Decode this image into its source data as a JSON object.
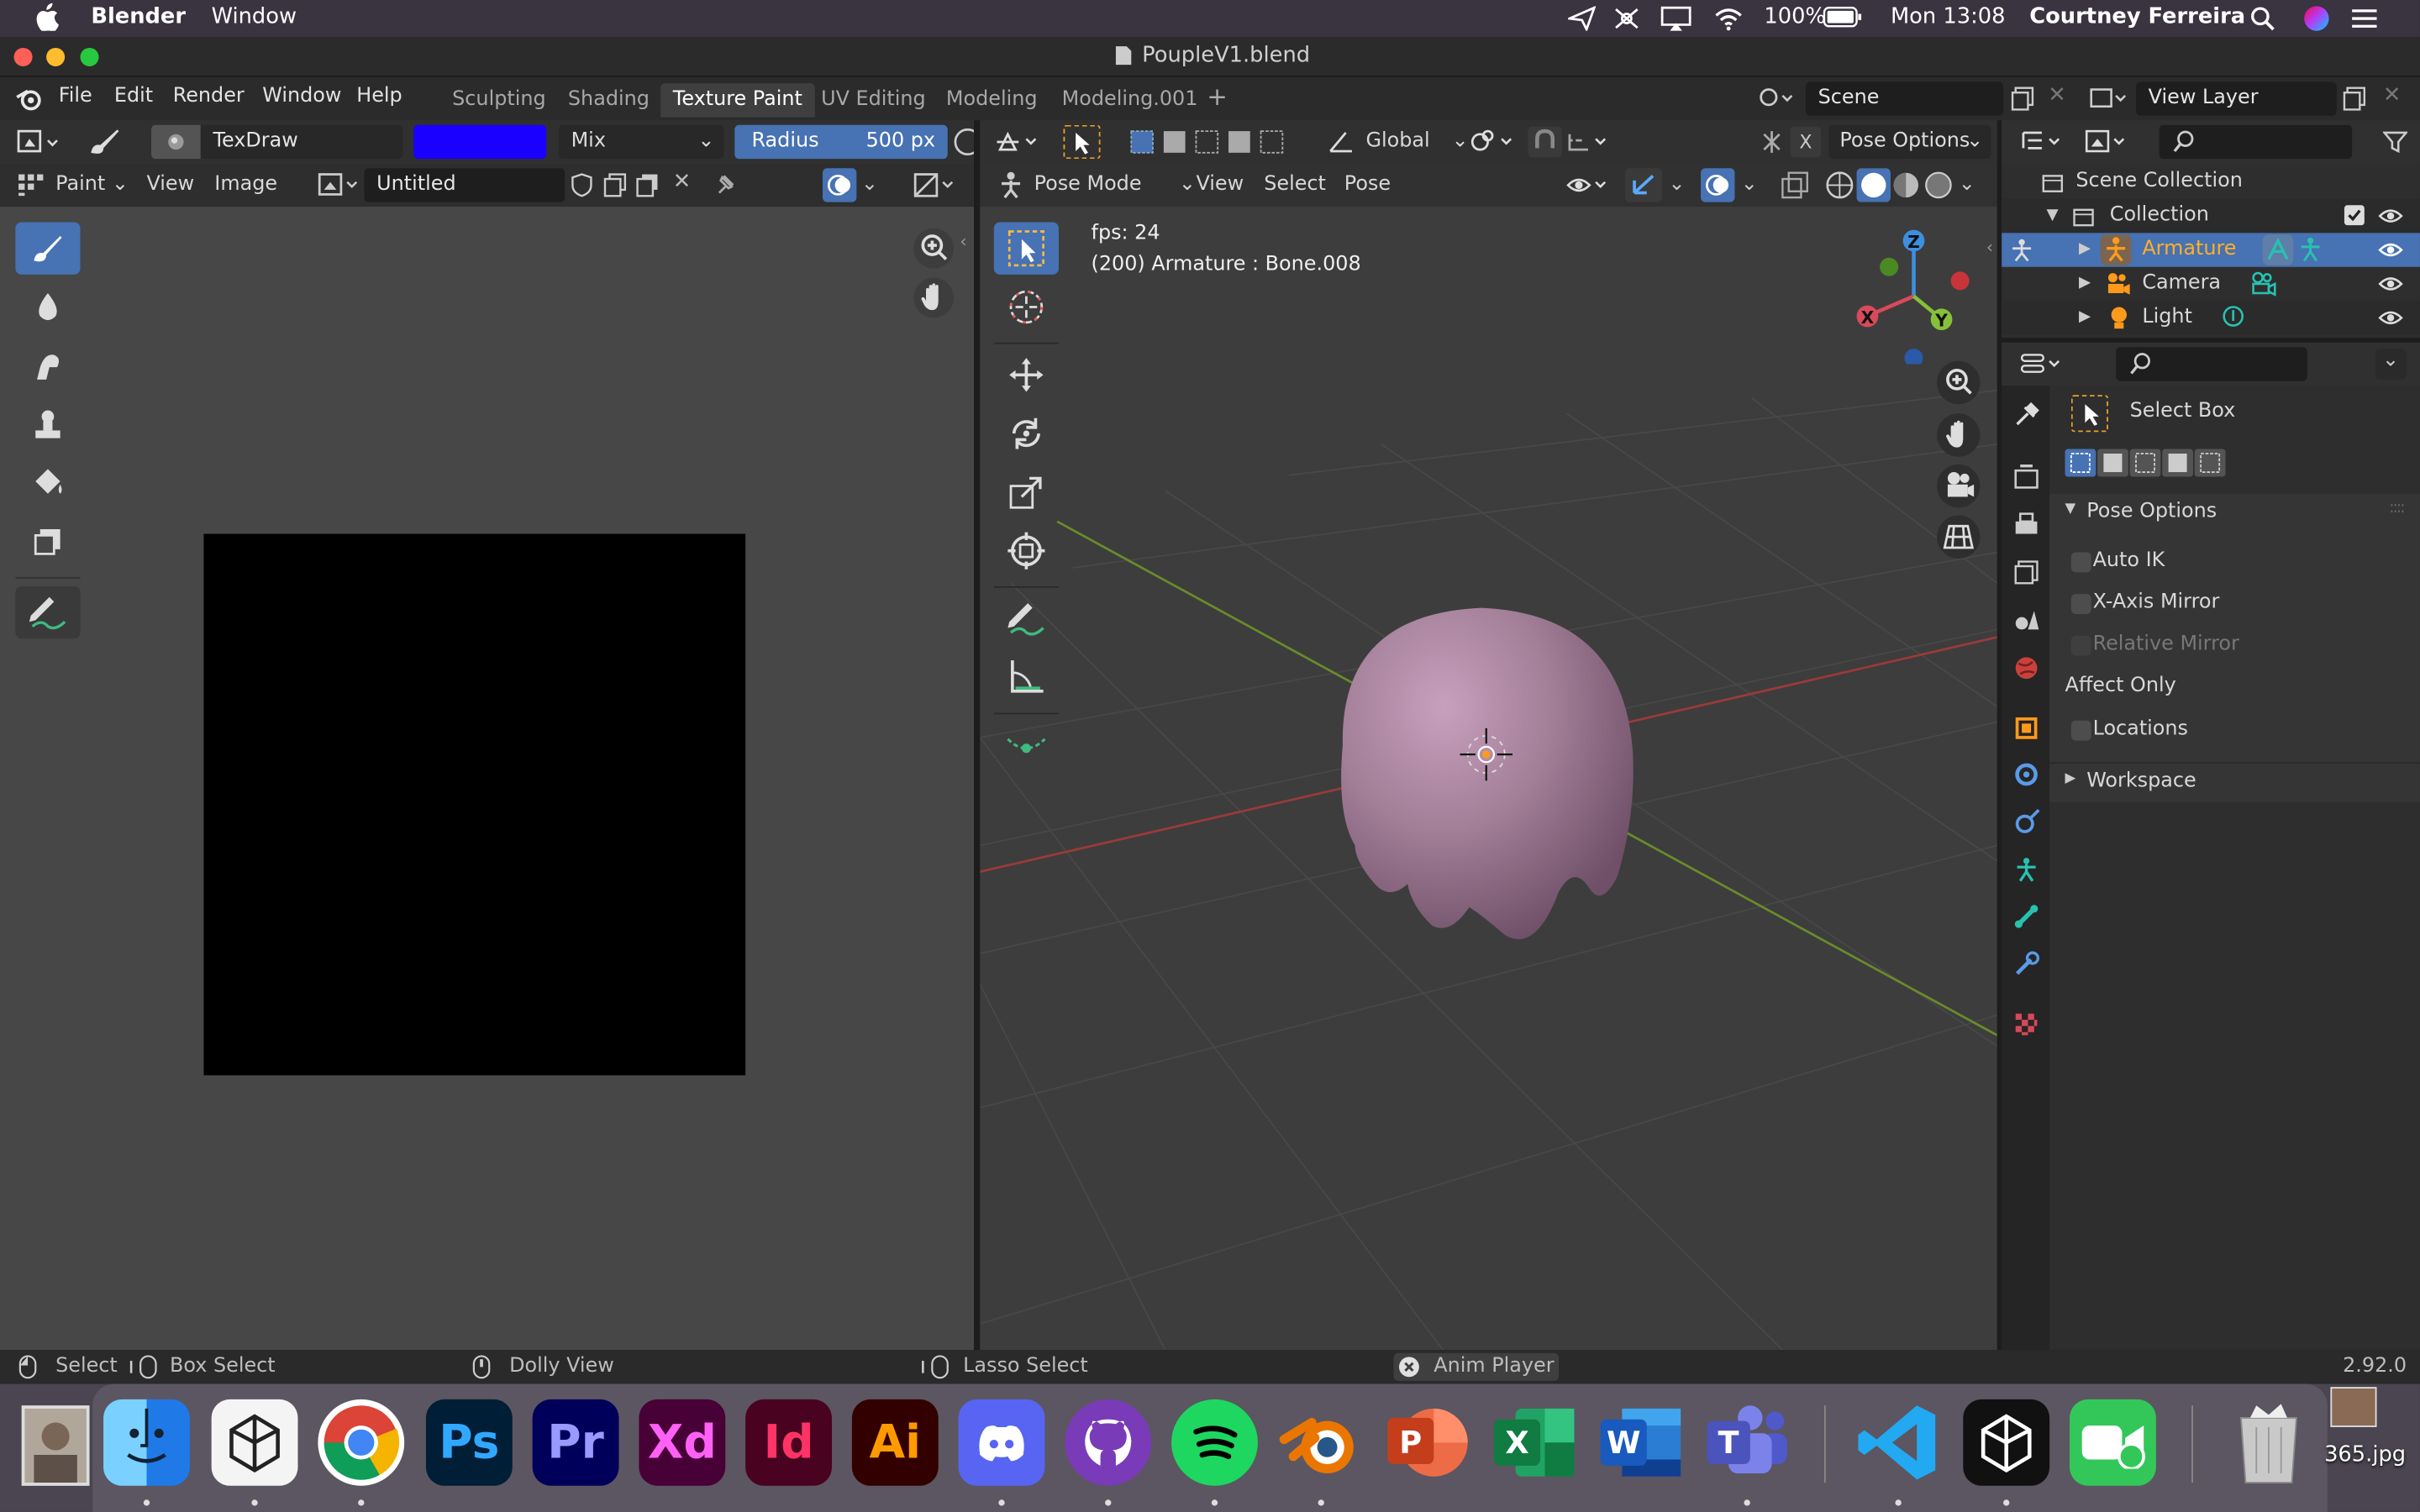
{
  "macos": {
    "app_name": "Blender",
    "menu": [
      "Window"
    ],
    "battery": "100%",
    "clock": "Mon 13:08",
    "user": "Courtney Ferreira"
  },
  "window": {
    "title": "PoupleV1.blend"
  },
  "top_menu": [
    "File",
    "Edit",
    "Render",
    "Window",
    "Help"
  ],
  "workspace_tabs": [
    {
      "label": "Sculpting",
      "active": false
    },
    {
      "label": "Shading",
      "active": false
    },
    {
      "label": "Texture Paint",
      "active": true
    },
    {
      "label": "UV Editing",
      "active": false
    },
    {
      "label": "Modeling",
      "active": false
    },
    {
      "label": "Modeling.001",
      "active": false
    }
  ],
  "scene": {
    "name": "Scene",
    "view_layer": "View Layer"
  },
  "image_editor": {
    "brush_name": "TexDraw",
    "brush_color": "#1a00ff",
    "blend_mode": "Mix",
    "radius_label": "Radius",
    "radius_value": "500 px",
    "mode": "Paint",
    "menus": [
      "View",
      "Image"
    ],
    "image_name": "Untitled"
  },
  "viewport": {
    "orientation": "Global",
    "pose_options": "Pose Options",
    "mode": "Pose Mode",
    "menus": [
      "View",
      "Select",
      "Pose"
    ],
    "fps": "fps: 24",
    "info": "(200) Armature : Bone.008",
    "axes": [
      "Z",
      "X",
      "Y"
    ]
  },
  "outliner": {
    "root": "Scene Collection",
    "collection": "Collection",
    "items": [
      {
        "label": "Armature",
        "selected": true
      },
      {
        "label": "Camera",
        "selected": false
      },
      {
        "label": "Light",
        "selected": false
      }
    ]
  },
  "properties": {
    "tool": "Select Box",
    "section": "Pose Options",
    "options": [
      {
        "label": "Auto IK",
        "checked": false,
        "disabled": false
      },
      {
        "label": "X-Axis Mirror",
        "checked": false,
        "disabled": false
      },
      {
        "label": "Relative Mirror",
        "checked": false,
        "disabled": true
      }
    ],
    "affect_only_label": "Affect Only",
    "locations_label": "Locations",
    "workspace_label": "Workspace"
  },
  "status": {
    "select": "Select",
    "box_select": "Box Select",
    "dolly": "Dolly View",
    "lasso": "Lasso Select",
    "anim_player": "Anim Player",
    "version": "2.92.0"
  },
  "dock": {
    "apps": [
      "Finder",
      "Unity",
      "Chrome",
      "Ps",
      "Pr",
      "Xd",
      "Id",
      "Ai",
      "Discord",
      "GitHub Desktop",
      "Spotify",
      "Blender",
      "PowerPoint",
      "Excel",
      "Word",
      "Teams",
      "VS Code",
      "Unity",
      "FaceTime",
      "Trash"
    ],
    "file_label": "365.jpg"
  },
  "colors": {
    "accent": "#4772b3",
    "selected_orange": "#ffaf29",
    "mesh": "#a27e97"
  }
}
